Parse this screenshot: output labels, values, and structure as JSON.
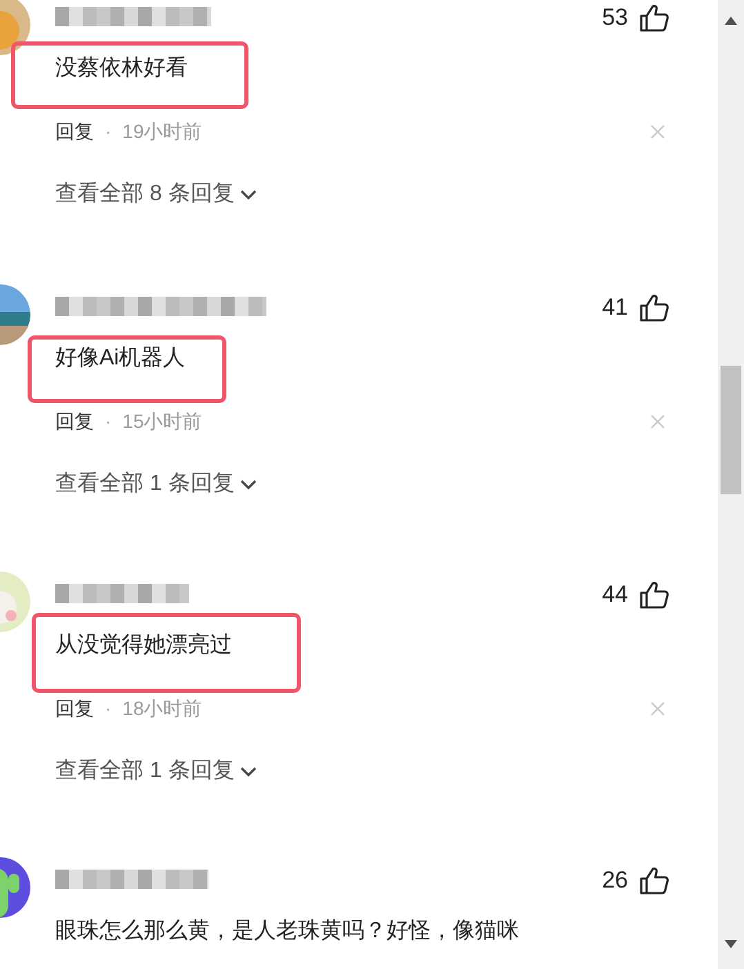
{
  "comments": [
    {
      "likes": "53",
      "text": "没蔡依林好看",
      "reply_label": "回复",
      "separator": "·",
      "time": "19小时前",
      "view_replies": "查看全部 8 条回复",
      "highlighted": true
    },
    {
      "likes": "41",
      "text": "好像Ai机器人",
      "reply_label": "回复",
      "separator": "·",
      "time": "15小时前",
      "view_replies": "查看全部 1 条回复",
      "highlighted": true
    },
    {
      "likes": "44",
      "text": "从没觉得她漂亮过",
      "reply_label": "回复",
      "separator": "·",
      "time": "18小时前",
      "view_replies": "查看全部 1 条回复",
      "highlighted": true
    },
    {
      "likes": "26",
      "text": "眼珠怎么那么黄，是人老珠黄吗？好怪，像猫咪",
      "highlighted": false
    }
  ]
}
